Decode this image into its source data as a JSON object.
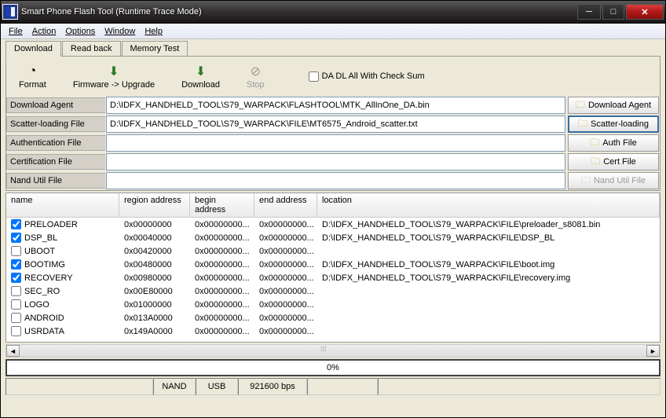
{
  "title": "Smart Phone Flash Tool (Runtime Trace Mode)",
  "menu": {
    "file": "File",
    "action": "Action",
    "options": "Options",
    "window": "Window",
    "help": "Help"
  },
  "tabs": {
    "download": "Download",
    "readback": "Read back",
    "memtest": "Memory Test"
  },
  "toolbar": {
    "format": "Format",
    "upgrade": "Firmware -> Upgrade",
    "download": "Download",
    "stop": "Stop",
    "checkbox": "DA DL All With Check Sum"
  },
  "form": {
    "labels": {
      "agent": "Download Agent",
      "scatter": "Scatter-loading File",
      "auth": "Authentication File",
      "cert": "Certification File",
      "nand": "Nand Util File"
    },
    "values": {
      "agent": "D:\\IDFX_HANDHELD_TOOL\\S79_WARPACK\\FLASHTOOL\\MTK_AllInOne_DA.bin",
      "scatter": "D:\\IDFX_HANDHELD_TOOL\\S79_WARPACK\\FILE\\MT6575_Android_scatter.txt",
      "auth": "",
      "cert": "",
      "nand": ""
    },
    "buttons": {
      "agent": "Download Agent",
      "scatter": "Scatter-loading",
      "auth": "Auth File",
      "cert": "Cert File",
      "nand": "Nand Util File"
    }
  },
  "table": {
    "headers": {
      "name": "name",
      "region": "region address",
      "begin": "begin address",
      "end": "end address",
      "loc": "location"
    },
    "rows": [
      {
        "checked": true,
        "name": "PRELOADER",
        "region": "0x00000000",
        "begin": "0x00000000...",
        "end": "0x00000000...",
        "loc": "D:\\IDFX_HANDHELD_TOOL\\S79_WARPACK\\FILE\\preloader_s8081.bin"
      },
      {
        "checked": true,
        "name": "DSP_BL",
        "region": "0x00040000",
        "begin": "0x00000000...",
        "end": "0x00000000...",
        "loc": "D:\\IDFX_HANDHELD_TOOL\\S79_WARPACK\\FILE\\DSP_BL"
      },
      {
        "checked": false,
        "name": "UBOOT",
        "region": "0x00420000",
        "begin": "0x00000000...",
        "end": "0x00000000...",
        "loc": ""
      },
      {
        "checked": true,
        "name": "BOOTIMG",
        "region": "0x00480000",
        "begin": "0x00000000...",
        "end": "0x00000000...",
        "loc": "D:\\IDFX_HANDHELD_TOOL\\S79_WARPACK\\FILE\\boot.img"
      },
      {
        "checked": true,
        "name": "RECOVERY",
        "region": "0x00980000",
        "begin": "0x00000000...",
        "end": "0x00000000...",
        "loc": "D:\\IDFX_HANDHELD_TOOL\\S79_WARPACK\\FILE\\recovery.img"
      },
      {
        "checked": false,
        "name": "SEC_RO",
        "region": "0x00E80000",
        "begin": "0x00000000...",
        "end": "0x00000000...",
        "loc": ""
      },
      {
        "checked": false,
        "name": "LOGO",
        "region": "0x01000000",
        "begin": "0x00000000...",
        "end": "0x00000000...",
        "loc": ""
      },
      {
        "checked": false,
        "name": "ANDROID",
        "region": "0x013A0000",
        "begin": "0x00000000...",
        "end": "0x00000000...",
        "loc": ""
      },
      {
        "checked": false,
        "name": "USRDATA",
        "region": "0x149A0000",
        "begin": "0x00000000...",
        "end": "0x00000000...",
        "loc": ""
      }
    ]
  },
  "progress": "0%",
  "status": {
    "nand": "NAND",
    "usb": "USB",
    "bps": "921600 bps"
  }
}
